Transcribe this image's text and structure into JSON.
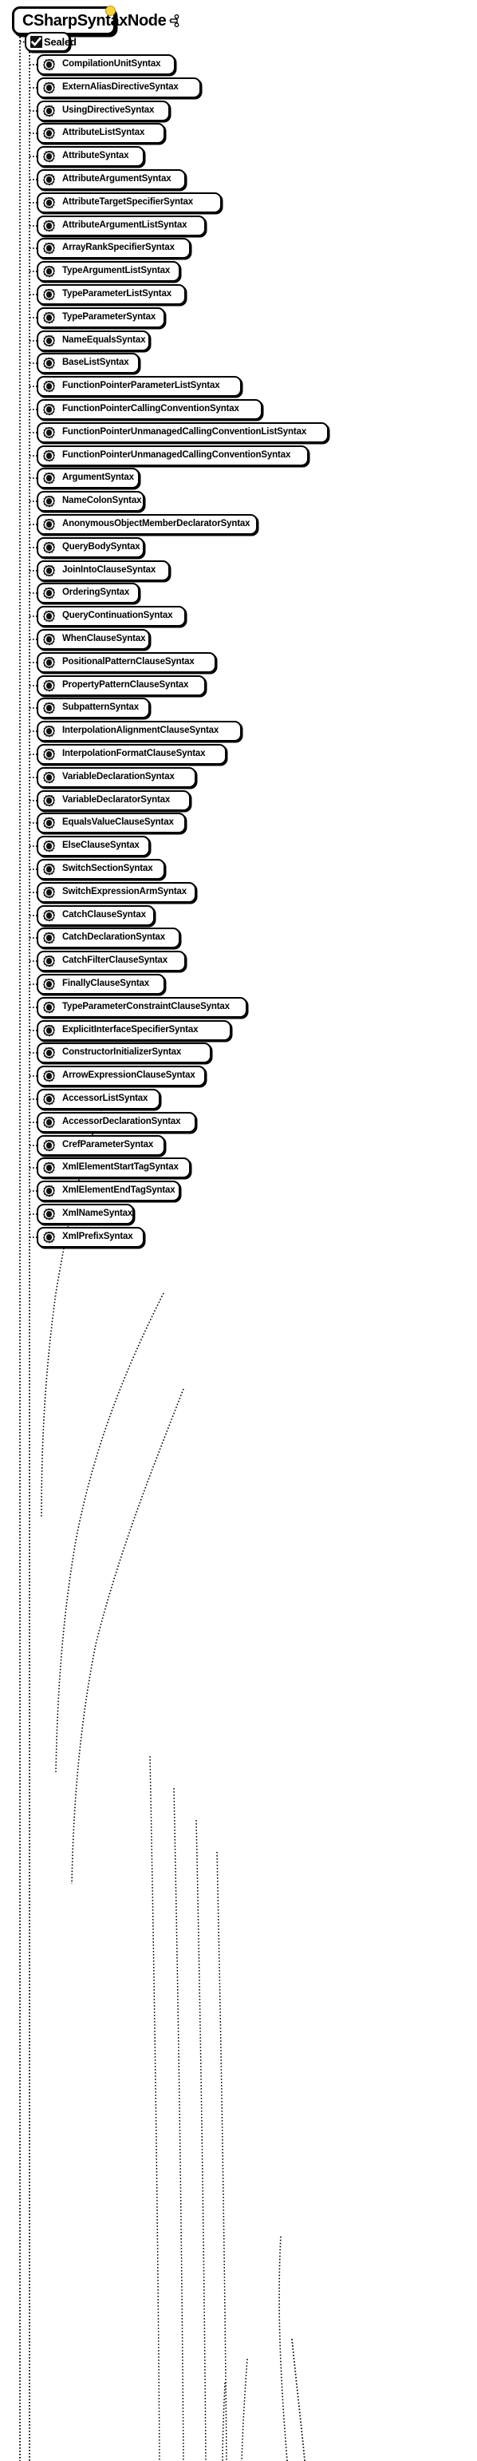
{
  "diagram": {
    "kind": "class-hierarchy",
    "root": {
      "label": "CSharpSyntaxNode",
      "icon": "class-hierarchy-icon",
      "pin": "yellow-pin-dot",
      "pin_color": "#f5d33a"
    },
    "modifier_node": {
      "label": "Sealed",
      "icon": "checkbox-checked-icon",
      "checked": true
    },
    "node_icon": "class-icon",
    "derived": [
      {
        "label": "CompilationUnitSyntax"
      },
      {
        "label": "ExternAliasDirectiveSyntax"
      },
      {
        "label": "UsingDirectiveSyntax"
      },
      {
        "label": "AttributeListSyntax"
      },
      {
        "label": "AttributeSyntax"
      },
      {
        "label": "AttributeArgumentSyntax"
      },
      {
        "label": "AttributeTargetSpecifierSyntax"
      },
      {
        "label": "AttributeArgumentListSyntax"
      },
      {
        "label": "ArrayRankSpecifierSyntax"
      },
      {
        "label": "TypeArgumentListSyntax"
      },
      {
        "label": "TypeParameterListSyntax"
      },
      {
        "label": "TypeParameterSyntax"
      },
      {
        "label": "NameEqualsSyntax"
      },
      {
        "label": "BaseListSyntax"
      },
      {
        "label": "FunctionPointerParameterListSyntax"
      },
      {
        "label": "FunctionPointerCallingConventionSyntax"
      },
      {
        "label": "FunctionPointerUnmanagedCallingConventionListSyntax"
      },
      {
        "label": "FunctionPointerUnmanagedCallingConventionSyntax"
      },
      {
        "label": "ArgumentSyntax"
      },
      {
        "label": "NameColonSyntax"
      },
      {
        "label": "AnonymousObjectMemberDeclaratorSyntax"
      },
      {
        "label": "QueryBodySyntax"
      },
      {
        "label": "JoinIntoClauseSyntax"
      },
      {
        "label": "OrderingSyntax"
      },
      {
        "label": "QueryContinuationSyntax"
      },
      {
        "label": "WhenClauseSyntax"
      },
      {
        "label": "PositionalPatternClauseSyntax"
      },
      {
        "label": "PropertyPatternClauseSyntax"
      },
      {
        "label": "SubpatternSyntax"
      },
      {
        "label": "InterpolationAlignmentClauseSyntax"
      },
      {
        "label": "InterpolationFormatClauseSyntax"
      },
      {
        "label": "VariableDeclarationSyntax"
      },
      {
        "label": "VariableDeclaratorSyntax"
      },
      {
        "label": "EqualsValueClauseSyntax"
      },
      {
        "label": "ElseClauseSyntax"
      },
      {
        "label": "SwitchSectionSyntax"
      },
      {
        "label": "SwitchExpressionArmSyntax"
      },
      {
        "label": "CatchClauseSyntax"
      },
      {
        "label": "CatchDeclarationSyntax"
      },
      {
        "label": "CatchFilterClauseSyntax"
      },
      {
        "label": "FinallyClauseSyntax"
      },
      {
        "label": "TypeParameterConstraintClauseSyntax"
      },
      {
        "label": "ExplicitInterfaceSpecifierSyntax"
      },
      {
        "label": "ConstructorInitializerSyntax"
      },
      {
        "label": "ArrowExpressionClauseSyntax"
      },
      {
        "label": "AccessorListSyntax"
      },
      {
        "label": "AccessorDeclarationSyntax"
      },
      {
        "label": "CrefParameterSyntax"
      },
      {
        "label": "XmlElementStartTagSyntax"
      },
      {
        "label": "XmlElementEndTagSyntax"
      },
      {
        "label": "XmlNameSyntax"
      },
      {
        "label": "XmlPrefixSyntax"
      }
    ]
  },
  "colors": {
    "stroke": "#000000",
    "fill": "#ffffff",
    "accent": "#f5d33a"
  }
}
